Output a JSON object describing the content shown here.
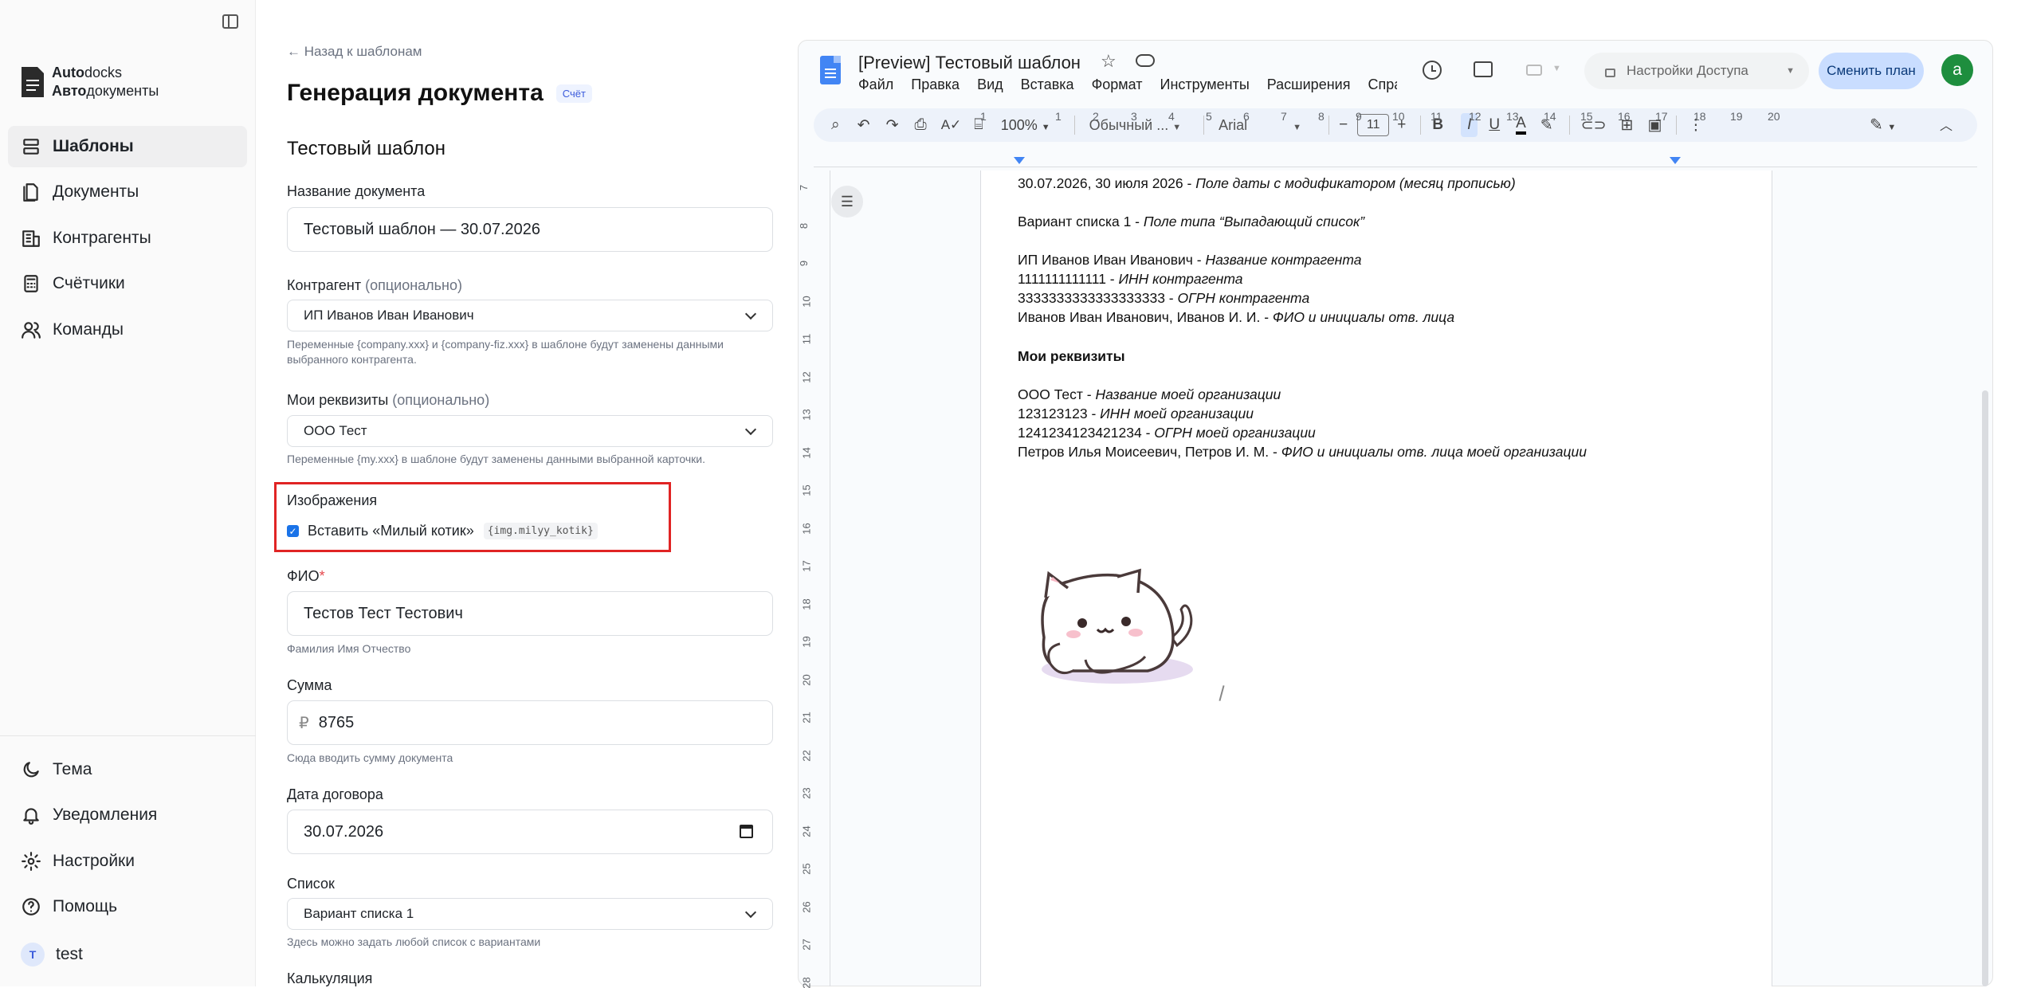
{
  "sidebar": {
    "logo_line1_bold": "Auto",
    "logo_line1_rest": "docks",
    "logo_line2_bold": "Авто",
    "logo_line2_rest": "документы",
    "items": [
      {
        "label": "Шаблоны",
        "icon": "stack-icon",
        "active": true
      },
      {
        "label": "Документы",
        "icon": "documents-icon"
      },
      {
        "label": "Контрагенты",
        "icon": "building-icon"
      },
      {
        "label": "Счётчики",
        "icon": "calculator-icon"
      },
      {
        "label": "Команды",
        "icon": "team-icon"
      }
    ],
    "bottom": [
      {
        "label": "Тема",
        "icon": "moon-icon"
      },
      {
        "label": "Уведомления",
        "icon": "bell-icon"
      },
      {
        "label": "Настройки",
        "icon": "gear-icon"
      },
      {
        "label": "Помощь",
        "icon": "help-icon"
      }
    ],
    "user": {
      "initial": "T",
      "name": "test"
    }
  },
  "form": {
    "back_link": "← Назад к шаблонам",
    "title": "Генерация документа",
    "badge": "Счёт",
    "template_name": "Тестовый шаблон",
    "doc_name_label": "Название документа",
    "doc_name_value": "Тестовый шаблон — 30.07.2026",
    "counterparty_label": "Контрагент",
    "counterparty_optional": "(опционально)",
    "counterparty_value": "ИП Иванов Иван Иванович",
    "counterparty_help": "Переменные {company.xxx} и {company-fiz.xxx} в шаблоне будут заменены данными выбранного контрагента.",
    "my_label": "Мои реквизиты",
    "my_optional": "(опционально)",
    "my_value": "ООО Тест",
    "my_help": "Переменные {my.xxx} в шаблоне будут заменены данными выбранной карточки.",
    "images_label": "Изображения",
    "image_checkbox_label": "Вставить «Милый котик»",
    "image_var": "{img.milyy_kotik}",
    "image_checked": true,
    "fio_label": "ФИО",
    "fio_required": "*",
    "fio_value": "Тестов Тест Тестович",
    "fio_help": "Фамилия Имя Отчество",
    "sum_label": "Сумма",
    "sum_currency": "₽",
    "sum_value": "8765",
    "sum_help": "Сюда вводить сумму документа",
    "date_label": "Дата договора",
    "date_value": "30.07.2026",
    "list_label": "Список",
    "list_value": "Вариант списка 1",
    "list_help": "Здесь можно задать любой список с вариантами",
    "calc_label": "Калькуляция"
  },
  "docs": {
    "title": "[Preview] Тестовый шаблон",
    "menu": [
      "Файл",
      "Правка",
      "Вид",
      "Вставка",
      "Формат",
      "Инструменты",
      "Расширения",
      "Справ"
    ],
    "access_button": "Настройки Доступа",
    "plan_button": "Сменить план",
    "avatar_initial": "a",
    "zoom": "100%",
    "style": "Обычный ...",
    "font": "Arial",
    "font_size": "11",
    "ruler_top": [
      "1",
      "1",
      "2",
      "3",
      "4",
      "5",
      "6",
      "7",
      "8",
      "9",
      "10",
      "11",
      "12",
      "13",
      "14",
      "15",
      "16",
      "17",
      "18",
      "19",
      "20"
    ],
    "ruler_left": [
      "7",
      "8",
      "9",
      "10",
      "11",
      "12",
      "13",
      "14",
      "15",
      "16",
      "17",
      "18",
      "19",
      "20",
      "21",
      "22",
      "23",
      "24",
      "25",
      "26",
      "27",
      "28"
    ],
    "lines": [
      {
        "plain": "30.07.2026, 30 июля 2026 - ",
        "italic": "Поле даты с модификатором (месяц прописью)"
      },
      {
        "plain": "Вариант списка 1 - ",
        "italic": "Поле типа “Выпадающий список”"
      },
      {
        "plain": "ИП Иванов Иван Иванович - ",
        "italic": "Название контрагента"
      },
      {
        "plain": "1111111111111 - ",
        "italic": "ИНН контрагента"
      },
      {
        "plain": "3333333333333333333 - ",
        "italic": "ОГРН контрагента"
      },
      {
        "plain": "Иванов Иван Иванович, Иванов И. И. - ",
        "italic": "ФИО и инициалы отв. лица"
      },
      {
        "bold": "Мои реквизиты"
      },
      {
        "plain": "ООО Тест - ",
        "italic": "Название моей организации"
      },
      {
        "plain": "123123123 - ",
        "italic": "ИНН моей организации"
      },
      {
        "plain": "1241234123421234 - ",
        "italic": "ОГРН моей организации"
      },
      {
        "plain": "Петров Илья Моисеевич, Петров И. М. - ",
        "italic": "ФИО и инициалы отв. лица моей организации"
      }
    ]
  },
  "colors": {
    "accent": "#c9ddff",
    "highlight_border": "#e02424",
    "docs_blue": "#4285f4",
    "avatar_green": "#1e8e3e"
  }
}
